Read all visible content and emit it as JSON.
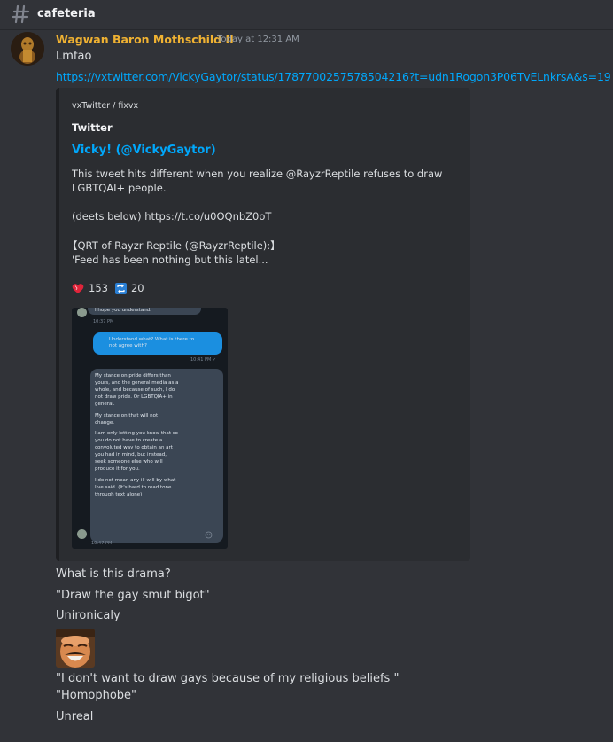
{
  "channel": {
    "name": "cafeteria"
  },
  "message": {
    "author": "Wagwan Baron Mothschild II",
    "timestamp": "Today at 12:31 AM",
    "text": "Lmfao",
    "link": "https://vxtwitter.com/VickyGaytor/status/1787700257578504216?t=udn1Rogon3P06TvELnkrsA&s=19"
  },
  "embed": {
    "provider": "vxTwitter / fixvx",
    "author": "Twitter",
    "title": "Vicky! (@VickyGaytor)",
    "desc_line1": "This tweet hits different when you realize @RayzrReptile refuses to draw",
    "desc_line2": "LGBTQAI+ people.",
    "desc_line3": "(deets below) https://t.co/u0OQnbZ0oT",
    "desc_line4": "【QRT of Rayzr Reptile (@RayzrReptile):】",
    "desc_line5": "'Feed has been nothing but this latel...",
    "likes": "153",
    "retweets": "20",
    "screenshot": {
      "msg1": "I hope you understand.",
      "time1": "10:37 PM",
      "reply_l1": "Understand what? What is there to",
      "reply_l2": "not agree with?",
      "reply_time": "10:41 PM ✓",
      "long_lines": [
        "My stance on pride differs than",
        "yours, and the general media as a",
        "whole, and because of such, I do",
        "not draw pride. Or LGBTQIA+ in",
        "general.",
        "",
        "My stance on that will not",
        "change.",
        "",
        "I am only letting you know that so",
        "you do not have to create a",
        "convoluted way to obtain an art",
        "you had in mind, but instead,",
        "seek someone else who will",
        "produce it for you.",
        "",
        "I do not mean any ill-will by what",
        "I've said. (It's hard to read tone",
        "through text alone)"
      ],
      "time2": "10:47 PM"
    }
  },
  "followups": [
    "What is this drama?",
    "\"Draw the gay smut bigot\"",
    "Unironicaly",
    "\"I don't want to draw gays because of my religious beliefs \"",
    "\"Homophobe\"",
    "Unreal"
  ],
  "colors": {
    "background": "#313338",
    "username": "#f0b232",
    "link": "#00a8fc",
    "embed_bg": "#2b2d31"
  }
}
